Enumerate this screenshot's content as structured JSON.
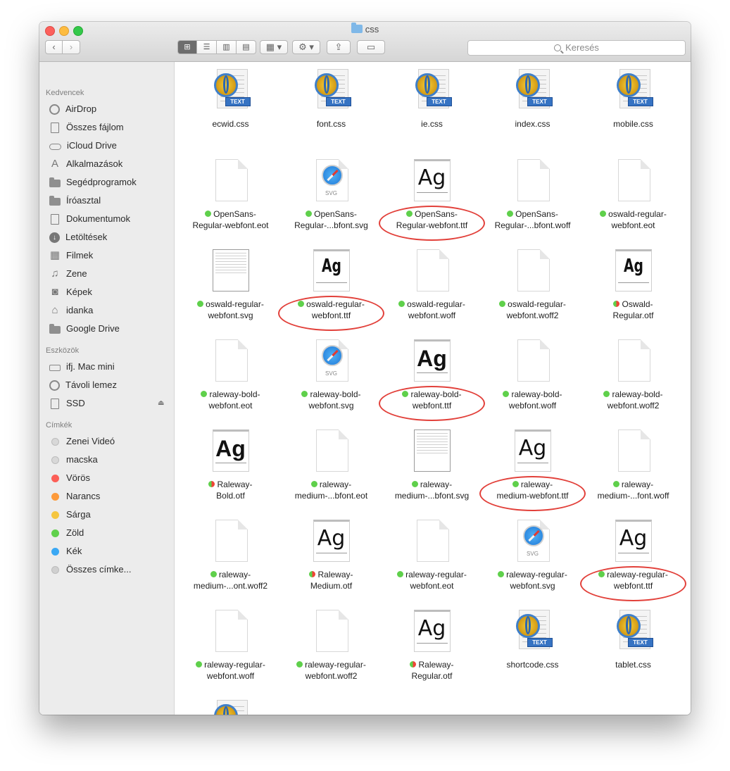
{
  "window": {
    "title": "css"
  },
  "toolbar": {
    "back_label": "‹",
    "forward_label": "›",
    "views": [
      "⊞",
      "☰",
      "▥",
      "▤"
    ],
    "arrange_label": "▦ ▾",
    "action_label": "⚙ ▾",
    "share_label": "⇪",
    "tag_label": "▭",
    "search_placeholder": "Keresés"
  },
  "sidebar": {
    "favorites_title": "Kedvencek",
    "favorites": [
      {
        "label": "AirDrop",
        "icon": "airdrop-icon"
      },
      {
        "label": "Összes fájlom",
        "icon": "all-files-icon"
      },
      {
        "label": "iCloud Drive",
        "icon": "cloud-icon"
      },
      {
        "label": "Alkalmazások",
        "icon": "applications-icon"
      },
      {
        "label": "Segédprogramok",
        "icon": "folder-icon"
      },
      {
        "label": "Íróasztal",
        "icon": "folder-icon"
      },
      {
        "label": "Dokumentumok",
        "icon": "document-icon"
      },
      {
        "label": "Letöltések",
        "icon": "download-icon"
      },
      {
        "label": "Filmek",
        "icon": "film-icon"
      },
      {
        "label": "Zene",
        "icon": "music-icon"
      },
      {
        "label": "Képek",
        "icon": "camera-icon"
      },
      {
        "label": "idanka",
        "icon": "home-icon"
      },
      {
        "label": "Google Drive",
        "icon": "folder-icon"
      }
    ],
    "devices_title": "Eszközök",
    "devices": [
      {
        "label": "ifj. Mac mini",
        "icon": "computer-icon"
      },
      {
        "label": "Távoli lemez",
        "icon": "disc-icon"
      },
      {
        "label": "SSD",
        "icon": "drive-icon"
      }
    ],
    "eject_label": "⏏",
    "tags_title": "Címkék",
    "tags": [
      {
        "label": "Zenei Videó",
        "color": "#d8d8d8"
      },
      {
        "label": "macska",
        "color": "#d8d8d8"
      },
      {
        "label": "Vörös",
        "color": "#fc5f57"
      },
      {
        "label": "Narancs",
        "color": "#fd9a3a"
      },
      {
        "label": "Sárga",
        "color": "#f5c640"
      },
      {
        "label": "Zöld",
        "color": "#5fd04b"
      },
      {
        "label": "Kék",
        "color": "#3ba8f4"
      },
      {
        "label": "Összes címke...",
        "color": "#d0d0d0"
      }
    ]
  },
  "files": [
    {
      "name": "ecwid.css",
      "type": "text",
      "tag": "none",
      "circled": false
    },
    {
      "name": "font.css",
      "type": "text",
      "tag": "none",
      "circled": false
    },
    {
      "name": "ie.css",
      "type": "text",
      "tag": "none",
      "circled": false
    },
    {
      "name": "index.css",
      "type": "text",
      "tag": "none",
      "circled": false
    },
    {
      "name": "mobile.css",
      "type": "text",
      "tag": "none",
      "circled": false
    },
    {
      "name": "OpenSans-\nRegular-webfont.eot",
      "type": "blank",
      "tag": "green",
      "circled": false
    },
    {
      "name": "OpenSans-\nRegular-...bfont.svg",
      "type": "safari",
      "tag": "green",
      "circled": false
    },
    {
      "name": "OpenSans-\nRegular-webfont.ttf",
      "type": "font-thin",
      "tag": "green",
      "circled": true
    },
    {
      "name": "OpenSans-\nRegular-...bfont.woff",
      "type": "blank",
      "tag": "green",
      "circled": false
    },
    {
      "name": "oswald-regular-\nwebfont.eot",
      "type": "blank",
      "tag": "green",
      "circled": false
    },
    {
      "name": "oswald-regular-\nwebfont.svg",
      "type": "svgdoc",
      "tag": "green",
      "circled": false
    },
    {
      "name": "oswald-regular-\nwebfont.ttf",
      "type": "font-cond",
      "tag": "green",
      "circled": true
    },
    {
      "name": "oswald-regular-\nwebfont.woff",
      "type": "blank",
      "tag": "green",
      "circled": false
    },
    {
      "name": "oswald-regular-\nwebfont.woff2",
      "type": "blank",
      "tag": "green",
      "circled": false
    },
    {
      "name": "Oswald-\nRegular.otf",
      "type": "font-cond",
      "tag": "green-red",
      "circled": false
    },
    {
      "name": "raleway-bold-\nwebfont.eot",
      "type": "blank",
      "tag": "green",
      "circled": false
    },
    {
      "name": "raleway-bold-\nwebfont.svg",
      "type": "safari",
      "tag": "green",
      "circled": false
    },
    {
      "name": "raleway-bold-\nwebfont.ttf",
      "type": "font-bold",
      "tag": "green",
      "circled": true
    },
    {
      "name": "raleway-bold-\nwebfont.woff",
      "type": "blank",
      "tag": "green",
      "circled": false
    },
    {
      "name": "raleway-bold-\nwebfont.woff2",
      "type": "blank",
      "tag": "green",
      "circled": false
    },
    {
      "name": "Raleway-\nBold.otf",
      "type": "font-bold",
      "tag": "green-red",
      "circled": false
    },
    {
      "name": "raleway-\nmedium-...bfont.eot",
      "type": "blank",
      "tag": "green",
      "circled": false
    },
    {
      "name": "raleway-\nmedium-...bfont.svg",
      "type": "svgdoc",
      "tag": "green",
      "circled": false
    },
    {
      "name": "raleway-\nmedium-webfont.ttf",
      "type": "font-thin",
      "tag": "green",
      "circled": true
    },
    {
      "name": "raleway-\nmedium-...font.woff",
      "type": "blank",
      "tag": "green",
      "circled": false
    },
    {
      "name": "raleway-\nmedium-...ont.woff2",
      "type": "blank",
      "tag": "green",
      "circled": false
    },
    {
      "name": "Raleway-\nMedium.otf",
      "type": "font-thin",
      "tag": "green-red",
      "circled": false
    },
    {
      "name": "raleway-regular-\nwebfont.eot",
      "type": "blank",
      "tag": "green",
      "circled": false
    },
    {
      "name": "raleway-regular-\nwebfont.svg",
      "type": "safari",
      "tag": "green",
      "circled": false
    },
    {
      "name": "raleway-regular-\nwebfont.ttf",
      "type": "font-thin",
      "tag": "green",
      "circled": true
    },
    {
      "name": "raleway-regular-\nwebfont.woff",
      "type": "blank",
      "tag": "green",
      "circled": false
    },
    {
      "name": "raleway-regular-\nwebfont.woff2",
      "type": "blank",
      "tag": "green",
      "circled": false
    },
    {
      "name": "Raleway-\nRegular.otf",
      "type": "font-thin",
      "tag": "green-red",
      "circled": false
    },
    {
      "name": "shortcode.css",
      "type": "text",
      "tag": "none",
      "circled": false
    },
    {
      "name": "tablet.css",
      "type": "text",
      "tag": "none",
      "circled": false
    },
    {
      "name": "",
      "type": "text",
      "tag": "none",
      "circled": false
    }
  ],
  "glyphs": {
    "ag": "Ag",
    "text_badge": "TEXT",
    "svg_badge": "SVG"
  }
}
